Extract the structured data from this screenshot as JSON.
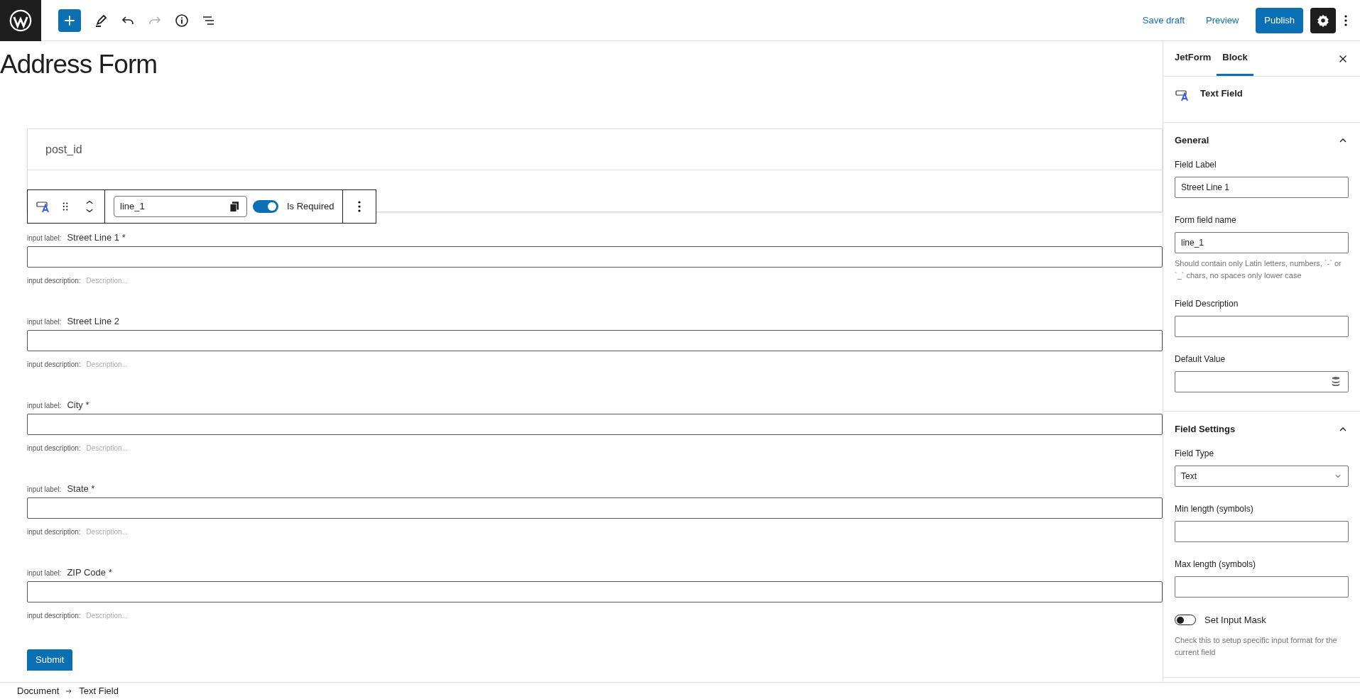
{
  "topbar": {
    "tools": [
      {
        "kind": "add",
        "disabled": false
      },
      {
        "kind": "edit",
        "disabled": false
      },
      {
        "kind": "undo",
        "disabled": false
      },
      {
        "kind": "redo",
        "disabled": true
      },
      {
        "kind": "info",
        "disabled": false
      },
      {
        "kind": "list",
        "disabled": false
      }
    ],
    "actions": [
      {
        "kind": "link",
        "label": "Save draft"
      },
      {
        "kind": "link",
        "label": "Preview"
      },
      {
        "kind": "primary",
        "label": "Publish"
      }
    ],
    "settings_selected": true
  },
  "title": "Address Form",
  "hidden_field": {
    "label": "post_id"
  },
  "block_toolbar": {
    "name_value": "line_1",
    "required_label": "Is Required",
    "required": true
  },
  "fields": [
    {
      "label_prefix": "input label:",
      "label": "Street Line 1 *",
      "desc_prefix": "input description:",
      "placeholder": "Description..."
    },
    {
      "label_prefix": "input label:",
      "label": "Street Line 2",
      "desc_prefix": "input description:",
      "placeholder": "Description..."
    },
    {
      "label_prefix": "input label:",
      "label": "City *",
      "desc_prefix": "input description:",
      "placeholder": "Description..."
    },
    {
      "label_prefix": "input label:",
      "label": "State *",
      "desc_prefix": "input description:",
      "placeholder": "Description..."
    },
    {
      "label_prefix": "input label:",
      "label": "ZIP Code *",
      "desc_prefix": "input description:",
      "placeholder": "Description..."
    }
  ],
  "submit": "Submit",
  "breadcrumb": [
    "Document",
    "Text Field"
  ],
  "sidebar": {
    "tabs": [
      {
        "label": "JetForm",
        "selected": false
      },
      {
        "label": "Block",
        "selected": true
      }
    ],
    "block_title": "Text Field",
    "panels": [
      {
        "title": "General",
        "expanded": true,
        "items": [
          {
            "kind": "input",
            "label": "Field Label",
            "value": "Street Line 1"
          },
          {
            "kind": "input",
            "label": "Form field name",
            "value": "line_1",
            "help": "Should contain only Latin letters, numbers, `-` or `_` chars, no spaces only lower case"
          },
          {
            "kind": "input",
            "label": "Field Description"
          },
          {
            "kind": "input_db",
            "label": "Default Value"
          }
        ]
      },
      {
        "title": "Field Settings",
        "expanded": true,
        "items": [
          {
            "kind": "select",
            "label": "Field Type",
            "value": "Text"
          },
          {
            "kind": "input",
            "label": "Min length (symbols)"
          },
          {
            "kind": "input",
            "label": "Max length (symbols)"
          },
          {
            "kind": "toggle",
            "label": "Set Input Mask",
            "on": false,
            "help": "Check this to setup specific input format for the current field"
          }
        ]
      }
    ]
  }
}
